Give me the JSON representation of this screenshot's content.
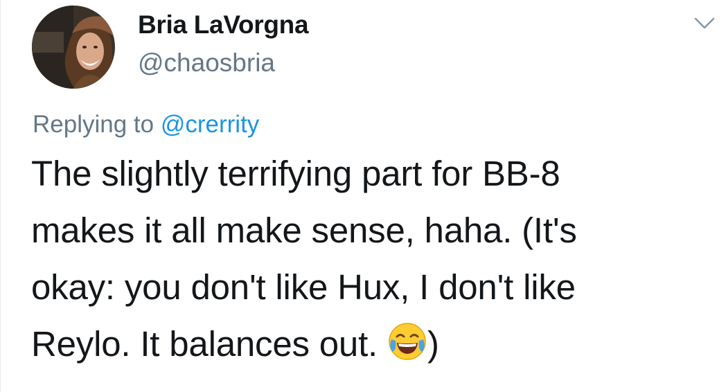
{
  "author": {
    "display_name": "Bria LaVorgna",
    "handle": "@chaosbria"
  },
  "reply": {
    "prefix": "Replying to ",
    "mention": "@crerrity"
  },
  "tweet": {
    "lines": [
      "The slightly terrifying part for BB-8",
      "makes it all make sense, haha. (It's",
      "okay: you don't like Hux, I don't like",
      "Reylo. It balances out. "
    ],
    "closing": ")",
    "emoji": "face-with-tears-of-joy-icon"
  },
  "icons": {
    "menu": "chevron-down-icon"
  },
  "colors": {
    "text": "#14171a",
    "secondary": "#657786",
    "link": "#1b95e0"
  }
}
